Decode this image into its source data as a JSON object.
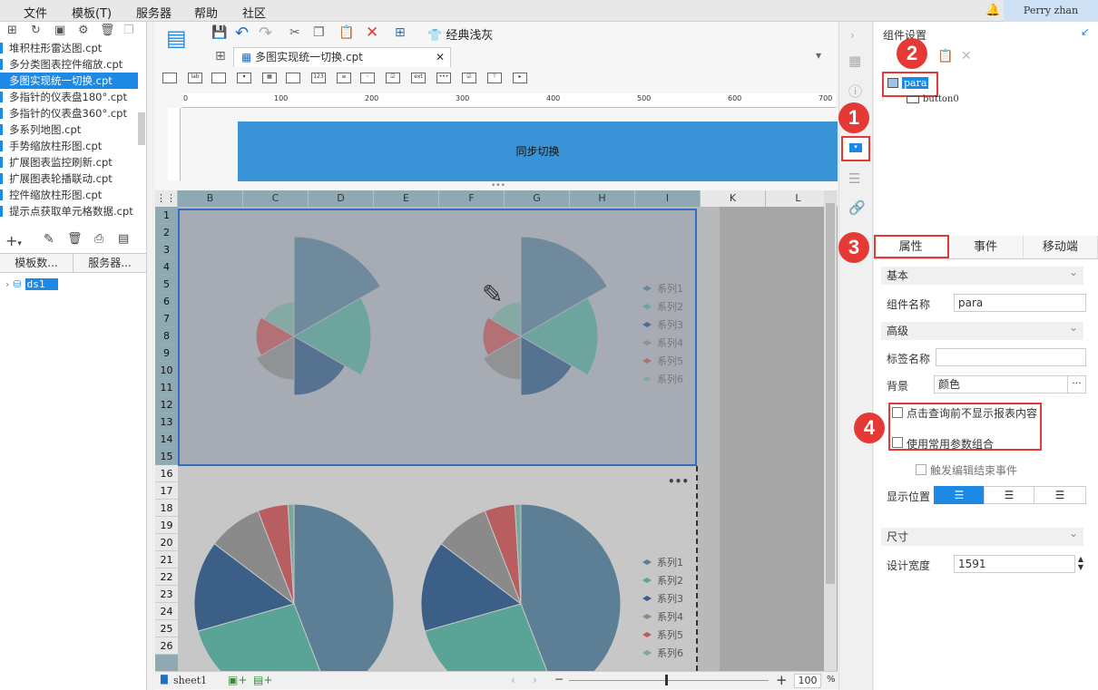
{
  "menu": [
    "文件",
    "模板(T)",
    "服务器",
    "帮助",
    "社区"
  ],
  "user": "Perry zhan",
  "file_list": [
    "堆积柱形雷达图.cpt",
    "多分类图表控件缩放.cpt",
    "多图实现统一切换.cpt",
    "多指针的仪表盘180°.cpt",
    "多指针的仪表盘360°.cpt",
    "多系列地图.cpt",
    "手势缩放柱形图.cpt",
    "扩展图表监控刷新.cpt",
    "扩展图表轮播联动.cpt",
    "控件缩放柱形图.cpt",
    "提示点获取单元格数据.cpt"
  ],
  "left_tabs": [
    "模板数...",
    "服务器..."
  ],
  "datasource": "ds1",
  "toolbar": {
    "style_button": "经典浅灰"
  },
  "doc_tab": "多图实现统一切换.cpt",
  "ruler_ticks": [
    "0",
    "100",
    "200",
    "300",
    "400",
    "500",
    "600",
    "700"
  ],
  "param_button": "同步切换",
  "columns": [
    "B",
    "C",
    "D",
    "E",
    "F",
    "G",
    "H",
    "I",
    "K",
    "L"
  ],
  "rows": [
    "1",
    "2",
    "3",
    "4",
    "5",
    "6",
    "7",
    "8",
    "9",
    "10",
    "11",
    "12",
    "13",
    "14",
    "15",
    "16",
    "17",
    "18",
    "19",
    "20",
    "21",
    "22",
    "23",
    "24",
    "25",
    "26"
  ],
  "legend": [
    "系列1",
    "系列2",
    "系列3",
    "系列4",
    "系列5",
    "系列6"
  ],
  "legend_colors": [
    "#5d7f96",
    "#5aa397",
    "#3b5f86",
    "#8a8a8a",
    "#b85e60",
    "#7aa89d"
  ],
  "sheet_tab": "sheet1",
  "zoom": "100",
  "zoom_unit": "%",
  "right_panel": {
    "title": "组件设置",
    "tree_root": "para",
    "tree_child": "button0",
    "tabs": [
      "属性",
      "事件",
      "移动端"
    ],
    "section_basic": "基本",
    "name_label": "组件名称",
    "name_value": "para",
    "section_adv": "高级",
    "tag_label": "标签名称",
    "tag_value": "",
    "bg_label": "背景",
    "bg_value": "颜色",
    "check1": "点击查询前不显示报表内容",
    "check2": "使用常用参数组合",
    "check3": "触发编辑结束事件",
    "position_label": "显示位置",
    "section_size": "尺寸",
    "width_label": "设计宽度",
    "width_value": "1591"
  },
  "badges": [
    "1",
    "2",
    "3",
    "4"
  ]
}
